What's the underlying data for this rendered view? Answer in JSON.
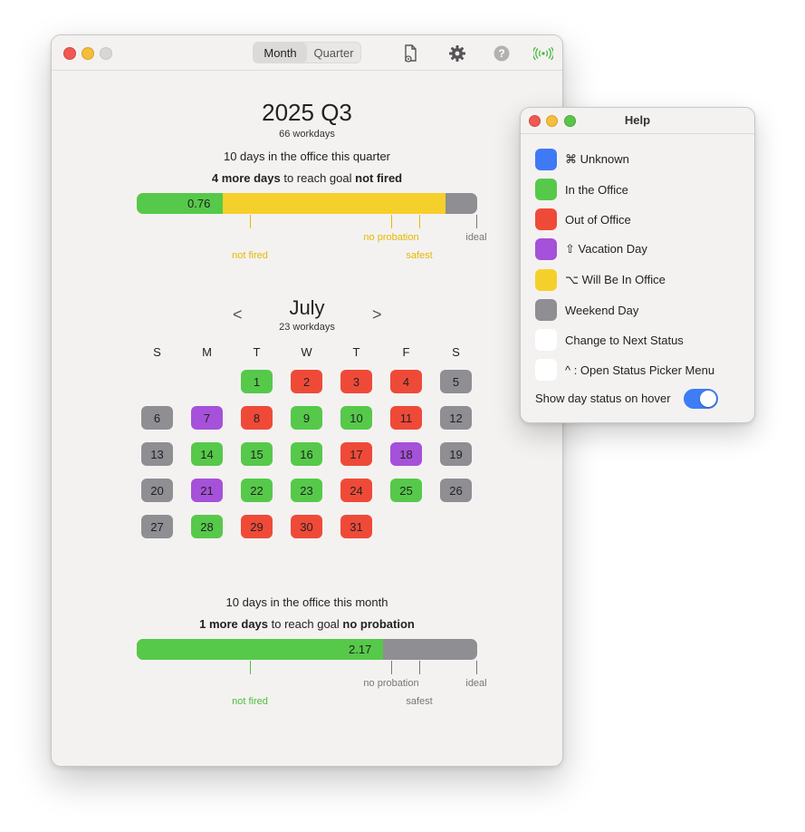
{
  "toolbar": {
    "tabs": [
      {
        "label": "Month",
        "active": true
      },
      {
        "label": "Quarter",
        "active": false
      }
    ],
    "icons": [
      "document-gear-icon",
      "gear-icon",
      "help-icon",
      "antenna-icon"
    ]
  },
  "quarter": {
    "title": "2025 Q3",
    "workdays": "66 workdays",
    "in_office": "10 days in the office this quarter",
    "goal": {
      "count": "4 more days",
      "mid": " to reach goal ",
      "target": "not fired"
    },
    "bar_value": "0.76",
    "ticks": [
      {
        "label": "not fired",
        "color": "#e6b800"
      },
      {
        "label": "no probation",
        "color": "#e6b800"
      },
      {
        "label": "safest",
        "color": "#e6b800"
      },
      {
        "label": "ideal",
        "color": "#777777"
      }
    ]
  },
  "month": {
    "name": "July",
    "workdays": "23 workdays",
    "prev": "<",
    "next": ">",
    "weekdays": [
      "S",
      "M",
      "T",
      "W",
      "T",
      "F",
      "S"
    ],
    "days": [
      {
        "d": "1",
        "s": "office"
      },
      {
        "d": "2",
        "s": "out"
      },
      {
        "d": "3",
        "s": "out"
      },
      {
        "d": "4",
        "s": "out"
      },
      {
        "d": "5",
        "s": "weekend"
      },
      {
        "d": "6",
        "s": "weekend"
      },
      {
        "d": "7",
        "s": "vacation"
      },
      {
        "d": "8",
        "s": "out"
      },
      {
        "d": "9",
        "s": "office"
      },
      {
        "d": "10",
        "s": "office"
      },
      {
        "d": "11",
        "s": "out"
      },
      {
        "d": "12",
        "s": "weekend"
      },
      {
        "d": "13",
        "s": "weekend"
      },
      {
        "d": "14",
        "s": "office"
      },
      {
        "d": "15",
        "s": "office"
      },
      {
        "d": "16",
        "s": "office"
      },
      {
        "d": "17",
        "s": "out"
      },
      {
        "d": "18",
        "s": "vacation"
      },
      {
        "d": "19",
        "s": "weekend"
      },
      {
        "d": "20",
        "s": "weekend"
      },
      {
        "d": "21",
        "s": "vacation"
      },
      {
        "d": "22",
        "s": "office"
      },
      {
        "d": "23",
        "s": "office"
      },
      {
        "d": "24",
        "s": "out"
      },
      {
        "d": "25",
        "s": "office"
      },
      {
        "d": "26",
        "s": "weekend"
      },
      {
        "d": "27",
        "s": "weekend"
      },
      {
        "d": "28",
        "s": "office"
      },
      {
        "d": "29",
        "s": "out"
      },
      {
        "d": "30",
        "s": "out"
      },
      {
        "d": "31",
        "s": "out"
      }
    ],
    "first_weekday": 2,
    "in_office": "10 days in the office this month",
    "goal": {
      "count": "1 more days",
      "mid": " to reach goal ",
      "target": "no probation"
    },
    "bar_value": "2.17",
    "ticks": [
      {
        "label": "not fired",
        "color": "#4cbf3a"
      },
      {
        "label": "no probation",
        "color": "#777777"
      },
      {
        "label": "safest",
        "color": "#777777"
      },
      {
        "label": "ideal",
        "color": "#777777"
      }
    ]
  },
  "colors": {
    "office": "#56c94a",
    "out": "#ef4a38",
    "vacation": "#a651d9",
    "weekend": "#8e8e93",
    "unknown": "#4079f5",
    "will_be": "#f6d02a",
    "empty": "#ffffff"
  },
  "help": {
    "title": "Help",
    "items": [
      {
        "label": "⌘  Unknown",
        "color": "#4079f5",
        "icon": "command-icon"
      },
      {
        "label": "In the Office",
        "color": "#56c94a"
      },
      {
        "label": "Out of Office",
        "color": "#ef4a38"
      },
      {
        "label": "⇧  Vacation Day",
        "color": "#a651d9",
        "icon": "shift-icon"
      },
      {
        "label": "⌥  Will Be In Office",
        "color": "#f6d02a",
        "icon": "option-icon"
      },
      {
        "label": "Weekend Day",
        "color": "#8e8e93"
      },
      {
        "label": "Change to Next Status",
        "color": "#ffffff",
        "icon": "click-icon"
      },
      {
        "label": "^ : Open Status Picker Menu",
        "color": "#ffffff",
        "icon": "click-icon"
      }
    ],
    "toggle_label": "Show day status on hover",
    "toggle_on": true
  }
}
